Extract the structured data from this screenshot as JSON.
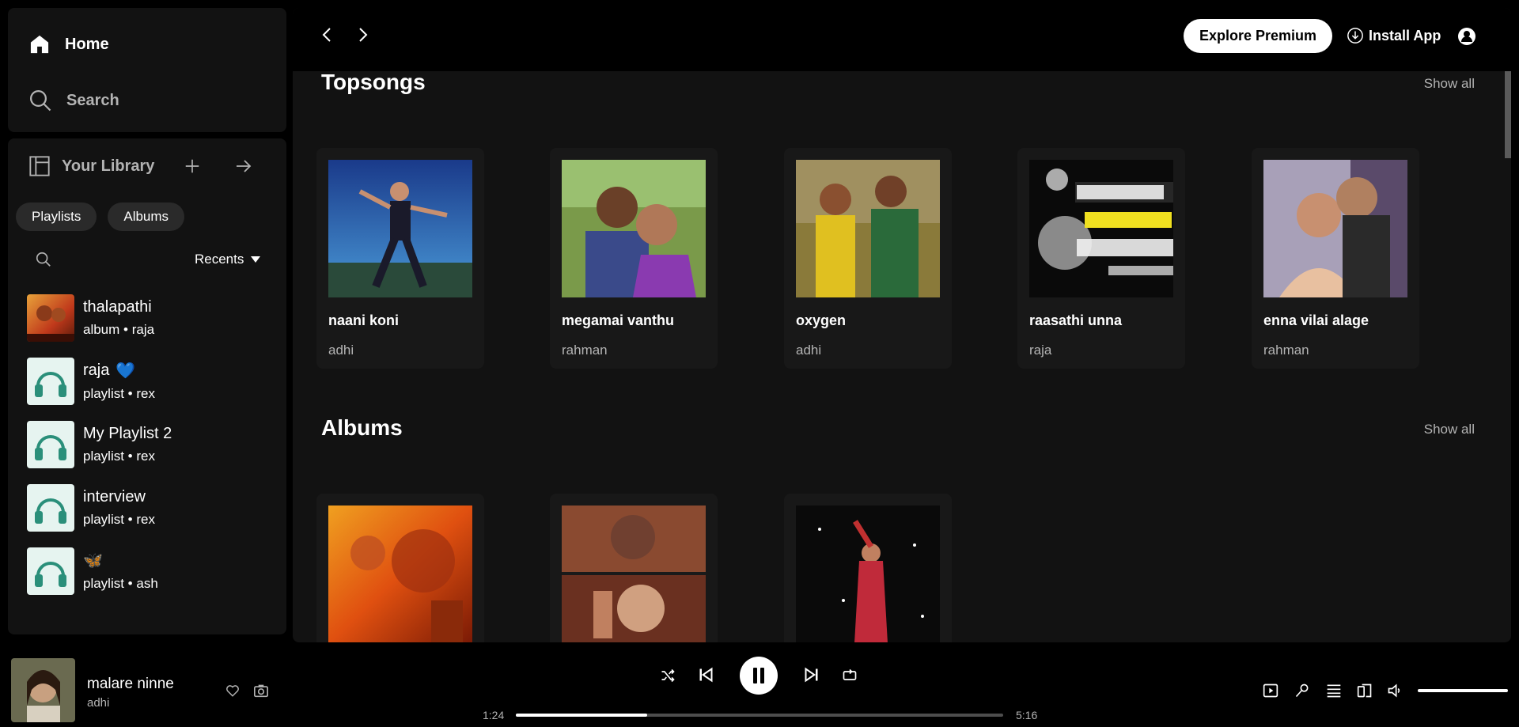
{
  "nav": {
    "home": "Home",
    "search": "Search"
  },
  "library": {
    "title": "Your Library",
    "chips": [
      "Playlists",
      "Albums"
    ],
    "sort": "Recents",
    "items": [
      {
        "name": "thalapathi",
        "sub": "album • raja"
      },
      {
        "name": "raja",
        "sub": "playlist • rex",
        "emoji": "💙"
      },
      {
        "name": "My Playlist 2",
        "sub": "playlist • rex"
      },
      {
        "name": "interview",
        "sub": "playlist • rex"
      },
      {
        "name": "",
        "sub": "playlist • ash",
        "emoji": "🦋"
      }
    ]
  },
  "header": {
    "premium": "Explore Premium",
    "install": "Install App"
  },
  "sections": {
    "topsongs": {
      "title": "Topsongs",
      "show_all": "Show all",
      "cards": [
        {
          "title": "naani koni",
          "sub": "adhi"
        },
        {
          "title": "megamai vanthu",
          "sub": "rahman"
        },
        {
          "title": "oxygen",
          "sub": "adhi"
        },
        {
          "title": "raasathi unna",
          "sub": "raja"
        },
        {
          "title": "enna vilai alage",
          "sub": "rahman"
        }
      ]
    },
    "albums": {
      "title": "Albums",
      "show_all": "Show all"
    }
  },
  "player": {
    "title": "malare ninne",
    "artist": "adhi",
    "elapsed": "1:24",
    "duration": "5:16",
    "progress": 0.27,
    "volume": 1.0
  },
  "colors": {
    "background": "#000000",
    "panel": "#121212",
    "card": "#181818",
    "muted": "#b3b3b3"
  }
}
